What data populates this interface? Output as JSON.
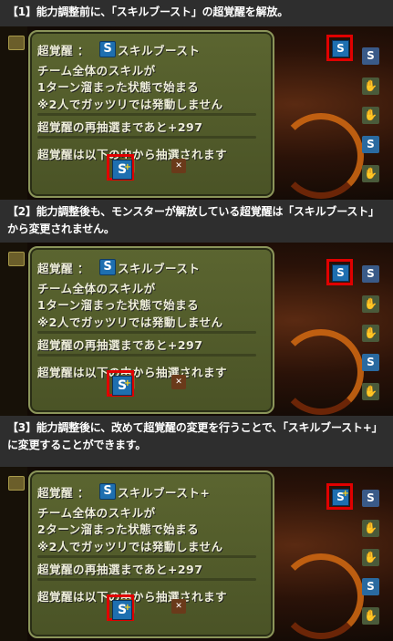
{
  "steps": [
    {
      "header": "【1】能力調整前に、「スキルブースト」の超覚醒を解放。",
      "title_label": "超覚醒 ：",
      "title_name": "スキルブースト",
      "plus": false,
      "desc1": "チーム全体のスキルが",
      "desc2": "1ターン溜まった状態で始まる",
      "desc3": "※2人でガッツリでは発動しません",
      "reroll": "超覚醒の再抽選まであと+297",
      "lottery": "超覚醒は以下の中から抽選されます"
    },
    {
      "header": "【2】能力調整後も、モンスターが解放している超覚醒は「スキルブースト」から変更されません。",
      "title_label": "超覚醒 ：",
      "title_name": "スキルブースト",
      "plus": false,
      "desc1": "チーム全体のスキルが",
      "desc2": "1ターン溜まった状態で始まる",
      "desc3": "※2人でガッツリでは発動しません",
      "reroll": "超覚醒の再抽選まであと+297",
      "lottery": "超覚醒は以下の中から抽選されます"
    },
    {
      "header": "【3】能力調整後に、改めて超覚醒の変更を行うことで、「スキルブースト+」に変更することができます。",
      "title_label": "超覚醒 ：",
      "title_name": "スキルブースト+",
      "plus": true,
      "desc1": "チーム全体のスキルが",
      "desc2": "2ターン溜まった状態で始まる",
      "desc3": "※2人でガッツリでは発動しません",
      "reroll": "超覚醒の再抽選まであと+297",
      "lottery": "超覚醒は以下の中から抽選されます"
    }
  ],
  "colors": {
    "highlight": "#e00000",
    "dialog": "#4f5829",
    "skill_icon": "#1e6fb0"
  },
  "icons": [
    "skill-boost-icon",
    "skill-boost-plus-icon",
    "hand-icon",
    "plus-hand-icon",
    "orb-icon"
  ]
}
